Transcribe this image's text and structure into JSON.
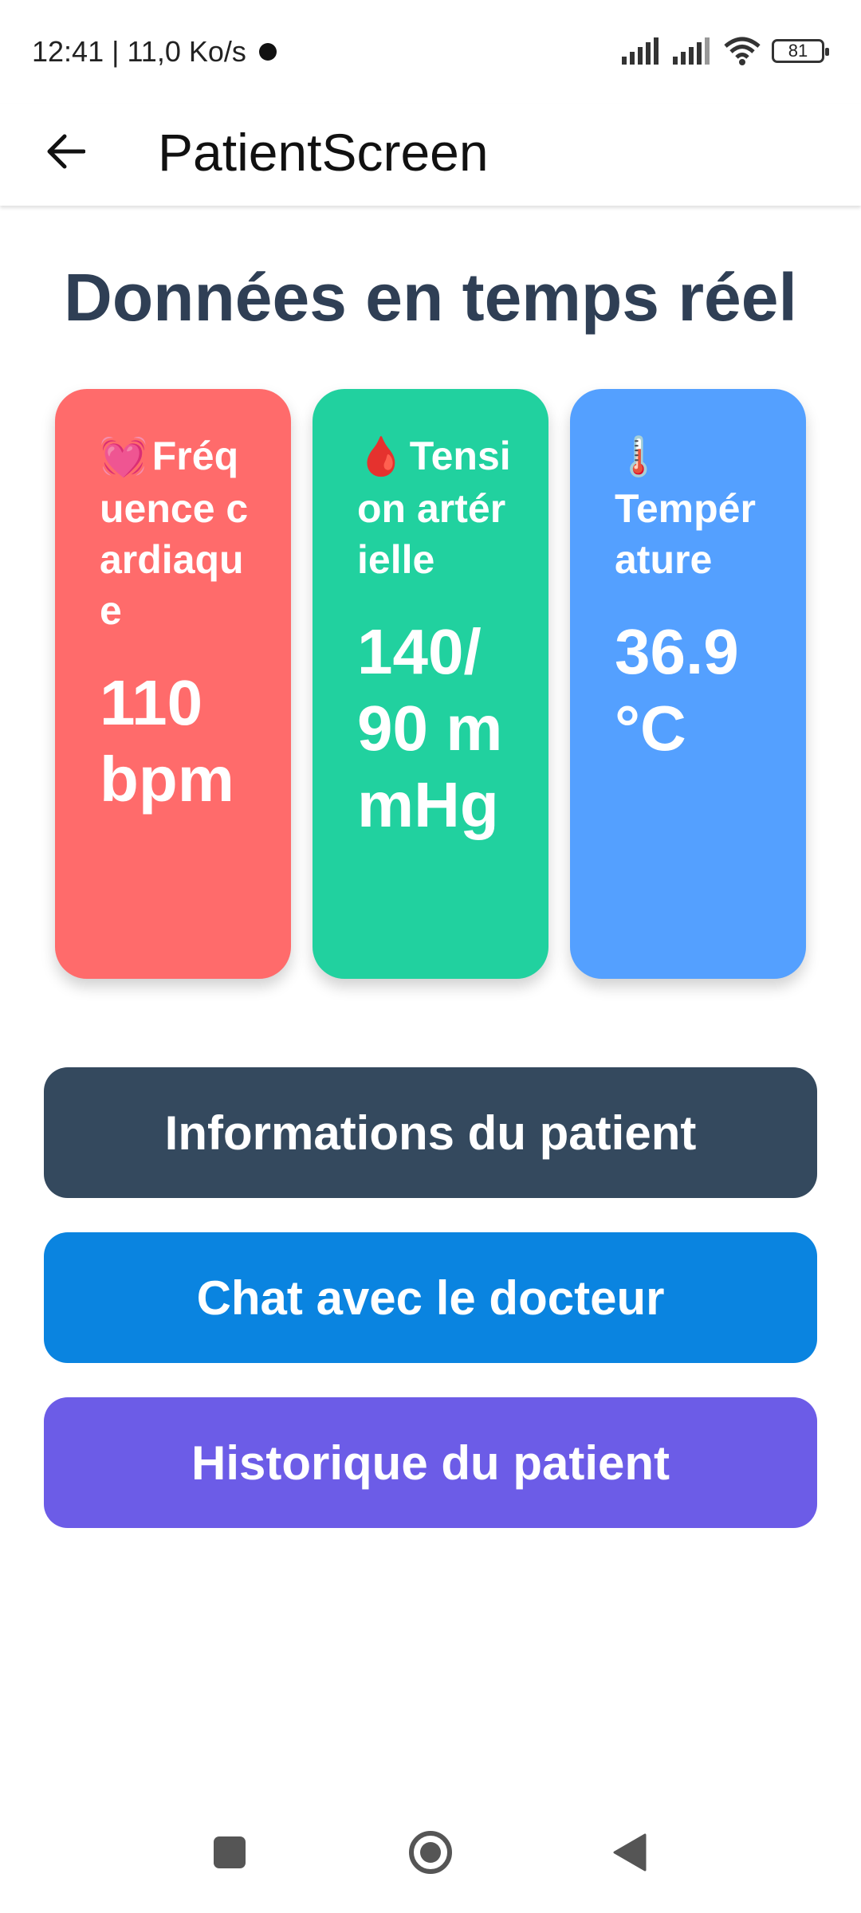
{
  "status_bar": {
    "time_speed": "12:41 | 11,0 Ko/s",
    "battery": "81"
  },
  "app_bar": {
    "title": "PatientScreen"
  },
  "heading": "Données en temps réel",
  "cards": [
    {
      "emoji": "💓",
      "label": "Fréquence cardiaque",
      "value": "110 bpm",
      "color": "#ff6b6b"
    },
    {
      "emoji": "🩸",
      "label": "Tension artérielle",
      "value": "140/90 mmHg",
      "color": "#21d19f"
    },
    {
      "emoji": "🌡️",
      "label": "Température",
      "value": "36.9 °C",
      "color": "#54a0ff"
    }
  ],
  "buttons": {
    "patient_info": "Informations du patient",
    "chat_doctor": "Chat avec le docteur",
    "patient_history": "Historique du patient"
  },
  "colors": {
    "heading": "#2f3f55",
    "btn_info": "#34495e",
    "btn_chat": "#0a84e0",
    "btn_history": "#6c5ce7"
  }
}
